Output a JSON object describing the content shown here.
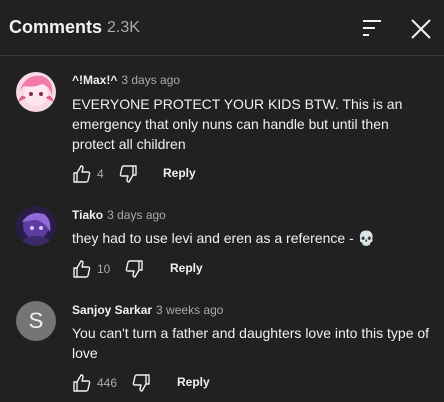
{
  "header": {
    "title": "Comments",
    "count": "2.3K",
    "sort_icon": "sort-icon",
    "close_icon": "close-icon"
  },
  "comments": [
    {
      "author": "^!Max!^",
      "time": "3 days ago",
      "text": "EVERYONE PROTECT YOUR KIDS BTW. This is an emergency that only nuns can handle but until then protect all children",
      "likes": "4",
      "reply_label": "Reply",
      "avatar": "anime-pink-hair-avatar"
    },
    {
      "author": "Tiako",
      "time": "3 days ago",
      "text": "they had to use levi and eren as a reference - 💀",
      "likes": "10",
      "reply_label": "Reply",
      "avatar": "anime-purple-avatar"
    },
    {
      "author": "Sanjoy Sarkar",
      "time": "3 weeks ago",
      "text": "You can't turn a father and daughters love into this type of love",
      "likes": "446",
      "reply_label": "Reply",
      "avatar_letter": "S"
    }
  ],
  "colors": {
    "background": "#212121",
    "text": "#f1f1f1",
    "secondary_text": "#aaaaaa"
  }
}
